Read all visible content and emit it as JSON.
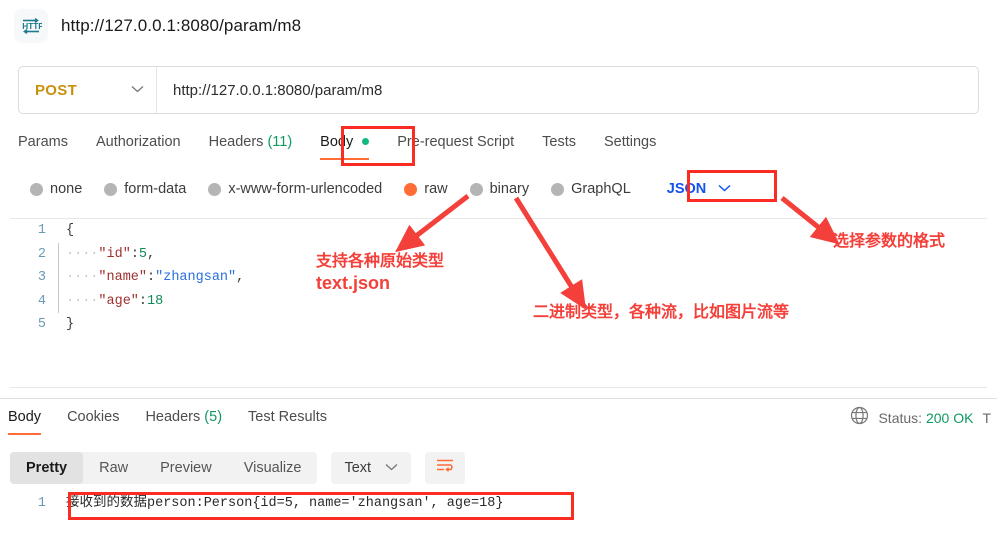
{
  "window": {
    "tab_icon": "http-icon",
    "tab_title": "http://127.0.0.1:8080/param/m8"
  },
  "request": {
    "method": "POST",
    "method_caret": "⌄",
    "url": "http://127.0.0.1:8080/param/m8",
    "tabs": [
      {
        "label": "Params",
        "count": "",
        "active": false,
        "dot": false
      },
      {
        "label": "Authorization",
        "count": "",
        "active": false,
        "dot": false
      },
      {
        "label": "Headers",
        "count": "(11)",
        "active": false,
        "dot": false
      },
      {
        "label": "Body",
        "count": "",
        "active": true,
        "dot": true
      },
      {
        "label": "Pre-request Script",
        "count": "",
        "active": false,
        "dot": false
      },
      {
        "label": "Tests",
        "count": "",
        "active": false,
        "dot": false
      },
      {
        "label": "Settings",
        "count": "",
        "active": false,
        "dot": false
      }
    ],
    "body_types": [
      {
        "label": "none",
        "selected": false
      },
      {
        "label": "form-data",
        "selected": false
      },
      {
        "label": "x-www-form-urlencoded",
        "selected": false
      },
      {
        "label": "raw",
        "selected": true
      },
      {
        "label": "binary",
        "selected": false
      },
      {
        "label": "GraphQL",
        "selected": false
      }
    ],
    "raw_format": "JSON",
    "raw_format_caret": "⌄"
  },
  "editor": {
    "lines": [
      {
        "num": "1",
        "indent": "",
        "content": "{",
        "type": "brace"
      },
      {
        "num": "2",
        "indent": "····",
        "key": "\"id\"",
        "sep": ":",
        "value": "5",
        "value_type": "num",
        "trail": ","
      },
      {
        "num": "3",
        "indent": "····",
        "key": "\"name\"",
        "sep": ":",
        "value": "\"zhangsan\"",
        "value_type": "str",
        "trail": ","
      },
      {
        "num": "4",
        "indent": "····",
        "key": "\"age\"",
        "sep": ":",
        "value": "18",
        "value_type": "num",
        "trail": ""
      },
      {
        "num": "5",
        "indent": "",
        "content": "}",
        "type": "brace"
      }
    ]
  },
  "response": {
    "tabs": [
      {
        "label": "Body",
        "count": "",
        "active": true
      },
      {
        "label": "Cookies",
        "count": "",
        "active": false
      },
      {
        "label": "Headers",
        "count": "(5)",
        "active": false
      },
      {
        "label": "Test Results",
        "count": "",
        "active": false
      }
    ],
    "globe_icon": "globe-icon",
    "status_label": "Status:",
    "status_value": "200 OK",
    "status_extra": "T",
    "format_buttons": [
      {
        "label": "Pretty",
        "active": true
      },
      {
        "label": "Raw",
        "active": false
      },
      {
        "label": "Preview",
        "active": false
      },
      {
        "label": "Visualize",
        "active": false
      }
    ],
    "content_type": "Text",
    "content_type_caret": "⌄",
    "wrap_icon": "word-wrap-icon",
    "body_line_number": "1",
    "body_text": "接收到的数据person:Person{id=5, name='zhangsan', age=18}"
  },
  "annotations": {
    "raw_note_line1": "支持各种原始类型",
    "raw_note_line2": "text.json",
    "binary_note": "二进制类型，各种流，比如图片流等",
    "format_note": "选择参数的格式",
    "highlight_color": "#fb2c22"
  }
}
